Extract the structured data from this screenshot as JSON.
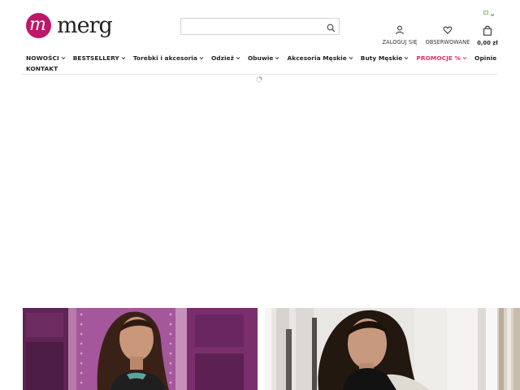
{
  "brand": {
    "name": "merg",
    "mark_letter": "m",
    "color": "#c0166a"
  },
  "search": {
    "value": "",
    "placeholder": "",
    "icon": "search-icon"
  },
  "language": {
    "flag": "flag-icon",
    "icon": "chevron-down-icon"
  },
  "account": {
    "login_label": "ZALOGUJ SIĘ",
    "favorites_label": "OBSERWOWANE",
    "cart_total": "0,00 zł"
  },
  "nav": {
    "items": [
      {
        "label": "NOWOŚCI",
        "has_dropdown": true
      },
      {
        "label": "BESTSELLERY",
        "has_dropdown": true
      },
      {
        "label": "Torebki i akcesoria",
        "has_dropdown": true
      },
      {
        "label": "Odzież",
        "has_dropdown": true
      },
      {
        "label": "Obuwie",
        "has_dropdown": true
      },
      {
        "label": "Akcesoria Męskie",
        "has_dropdown": true
      },
      {
        "label": "Buty Męskie",
        "has_dropdown": true
      },
      {
        "label": "PROMOCJE %",
        "has_dropdown": true,
        "accent": "#d8326a"
      },
      {
        "label": "Opinie",
        "has_dropdown": false
      },
      {
        "label": "KONTAKT",
        "has_dropdown": false
      }
    ]
  },
  "banners": [
    {
      "icon": "promo-photo-woman-pink-door"
    },
    {
      "icon": "promo-photo-woman-white-street"
    },
    {
      "icon": "promo-photo-partial"
    }
  ]
}
